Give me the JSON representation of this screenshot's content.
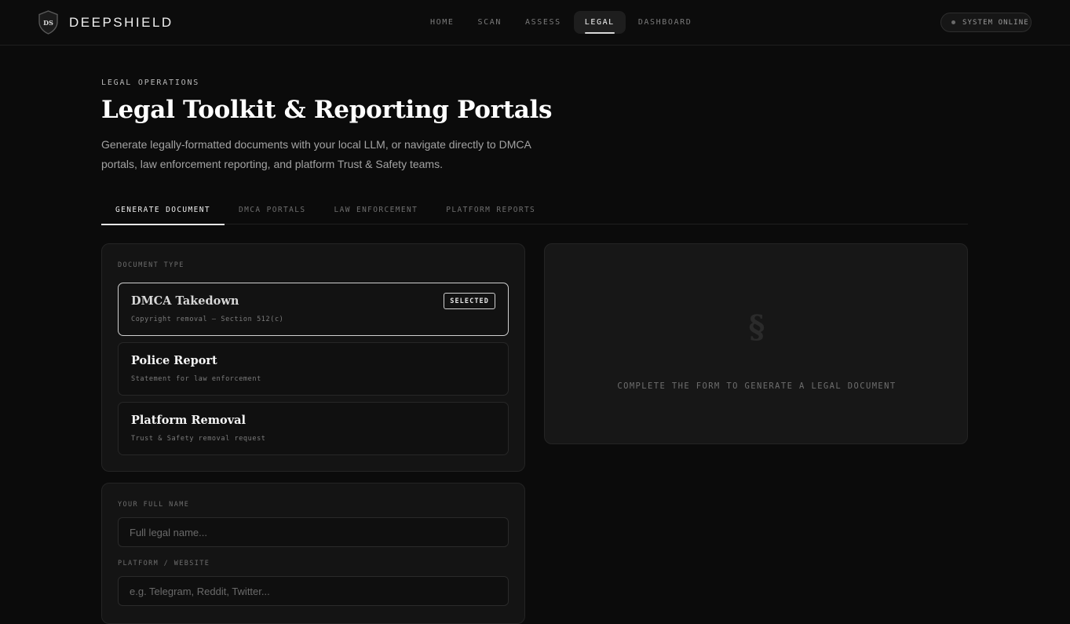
{
  "brand": {
    "logo_text": "DS",
    "name": "DEEPSHIELD"
  },
  "nav": {
    "items": [
      {
        "label": "HOME",
        "active": false
      },
      {
        "label": "SCAN",
        "active": false
      },
      {
        "label": "ASSESS",
        "active": false
      },
      {
        "label": "LEGAL",
        "active": true
      },
      {
        "label": "DASHBOARD",
        "active": false
      }
    ]
  },
  "status": {
    "label": "SYSTEM ONLINE"
  },
  "header": {
    "eyebrow": "LEGAL OPERATIONS",
    "title": "Legal Toolkit & Reporting Portals",
    "subtitle": "Generate legally-formatted documents with your local LLM, or navigate directly to DMCA portals, law enforcement reporting, and platform Trust & Safety teams."
  },
  "tabs": [
    {
      "label": "GENERATE DOCUMENT",
      "active": true
    },
    {
      "label": "DMCA PORTALS",
      "active": false
    },
    {
      "label": "LAW ENFORCEMENT",
      "active": false
    },
    {
      "label": "PLATFORM REPORTS",
      "active": false
    }
  ],
  "document_type": {
    "label": "DOCUMENT TYPE",
    "selected_badge": "SELECTED",
    "options": [
      {
        "title": "DMCA Takedown",
        "desc": "Copyright removal — Section 512(c)",
        "selected": true
      },
      {
        "title": "Police Report",
        "desc": "Statement for law enforcement",
        "selected": false
      },
      {
        "title": "Platform Removal",
        "desc": "Trust & Safety removal request",
        "selected": false
      }
    ]
  },
  "form": {
    "name_label": "YOUR FULL NAME",
    "name_placeholder": "Full legal name...",
    "platform_label": "PLATFORM / WEBSITE",
    "platform_placeholder": "e.g. Telegram, Reddit, Twitter..."
  },
  "preview": {
    "icon_glyph": "§",
    "message": "COMPLETE THE FORM TO GENERATE A LEGAL DOCUMENT"
  },
  "colors": {
    "background": "#0b0b0b",
    "card": "#141414",
    "accent": "#e6e6e6"
  }
}
